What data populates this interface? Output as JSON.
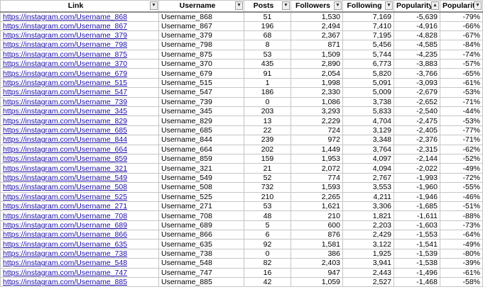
{
  "columns": [
    "Link",
    "Username",
    "Posts",
    "Followers",
    "Following",
    "Popularity",
    "Popularity"
  ],
  "filter_icon": "dropdown-arrow-icon",
  "rows": [
    [
      "https://instagram.com/Username_868",
      "Username_868",
      "51",
      "1,530",
      "7,169",
      "-5,639",
      "-79%"
    ],
    [
      "https://instagram.com/Username_867",
      "Username_867",
      "196",
      "2,494",
      "7,410",
      "-4,916",
      "-66%"
    ],
    [
      "https://instagram.com/Username_379",
      "Username_379",
      "68",
      "2,367",
      "7,195",
      "-4,828",
      "-67%"
    ],
    [
      "https://instagram.com/Username_798",
      "Username_798",
      "8",
      "871",
      "5,456",
      "-4,585",
      "-84%"
    ],
    [
      "https://instagram.com/Username_875",
      "Username_875",
      "53",
      "1,509",
      "5,744",
      "-4,235",
      "-74%"
    ],
    [
      "https://instagram.com/Username_370",
      "Username_370",
      "435",
      "2,890",
      "6,773",
      "-3,883",
      "-57%"
    ],
    [
      "https://instagram.com/Username_679",
      "Username_679",
      "91",
      "2,054",
      "5,820",
      "-3,766",
      "-65%"
    ],
    [
      "https://instagram.com/Username_515",
      "Username_515",
      "1",
      "1,998",
      "5,091",
      "-3,093",
      "-61%"
    ],
    [
      "https://instagram.com/Username_547",
      "Username_547",
      "186",
      "2,330",
      "5,009",
      "-2,679",
      "-53%"
    ],
    [
      "https://instagram.com/Username_739",
      "Username_739",
      "0",
      "1,086",
      "3,738",
      "-2,652",
      "-71%"
    ],
    [
      "https://instagram.com/Username_345",
      "Username_345",
      "203",
      "3,293",
      "5,833",
      "-2,540",
      "-44%"
    ],
    [
      "https://instagram.com/Username_829",
      "Username_829",
      "13",
      "2,229",
      "4,704",
      "-2,475",
      "-53%"
    ],
    [
      "https://instagram.com/Username_685",
      "Username_685",
      "22",
      "724",
      "3,129",
      "-2,405",
      "-77%"
    ],
    [
      "https://instagram.com/Username_844",
      "Username_844",
      "239",
      "972",
      "3,348",
      "-2,376",
      "-71%"
    ],
    [
      "https://instagram.com/Username_664",
      "Username_664",
      "202",
      "1,449",
      "3,764",
      "-2,315",
      "-62%"
    ],
    [
      "https://instagram.com/Username_859",
      "Username_859",
      "159",
      "1,953",
      "4,097",
      "-2,144",
      "-52%"
    ],
    [
      "https://instagram.com/Username_321",
      "Username_321",
      "21",
      "2,072",
      "4,094",
      "-2,022",
      "-49%"
    ],
    [
      "https://instagram.com/Username_549",
      "Username_549",
      "52",
      "774",
      "2,767",
      "-1,993",
      "-72%"
    ],
    [
      "https://instagram.com/Username_508",
      "Username_508",
      "732",
      "1,593",
      "3,553",
      "-1,960",
      "-55%"
    ],
    [
      "https://instagram.com/Username_525",
      "Username_525",
      "210",
      "2,265",
      "4,211",
      "-1,946",
      "-46%"
    ],
    [
      "https://instagram.com/Username_271",
      "Username_271",
      "53",
      "1,621",
      "3,306",
      "-1,685",
      "-51%"
    ],
    [
      "https://instagram.com/Username_708",
      "Username_708",
      "48",
      "210",
      "1,821",
      "-1,611",
      "-88%"
    ],
    [
      "https://instagram.com/Username_689",
      "Username_689",
      "5",
      "600",
      "2,203",
      "-1,603",
      "-73%"
    ],
    [
      "https://instagram.com/Username_866",
      "Username_866",
      "6",
      "876",
      "2,429",
      "-1,553",
      "-64%"
    ],
    [
      "https://instagram.com/Username_635",
      "Username_635",
      "92",
      "1,581",
      "3,122",
      "-1,541",
      "-49%"
    ],
    [
      "https://instagram.com/Username_738",
      "Username_738",
      "0",
      "386",
      "1,925",
      "-1,539",
      "-80%"
    ],
    [
      "https://instagram.com/Username_548",
      "Username_548",
      "82",
      "2,403",
      "3,941",
      "-1,538",
      "-39%"
    ],
    [
      "https://instagram.com/Username_747",
      "Username_747",
      "16",
      "947",
      "2,443",
      "-1,496",
      "-61%"
    ],
    [
      "https://instagram.com/Username_885",
      "Username_885",
      "42",
      "1,059",
      "2,527",
      "-1,468",
      "-58%"
    ]
  ]
}
